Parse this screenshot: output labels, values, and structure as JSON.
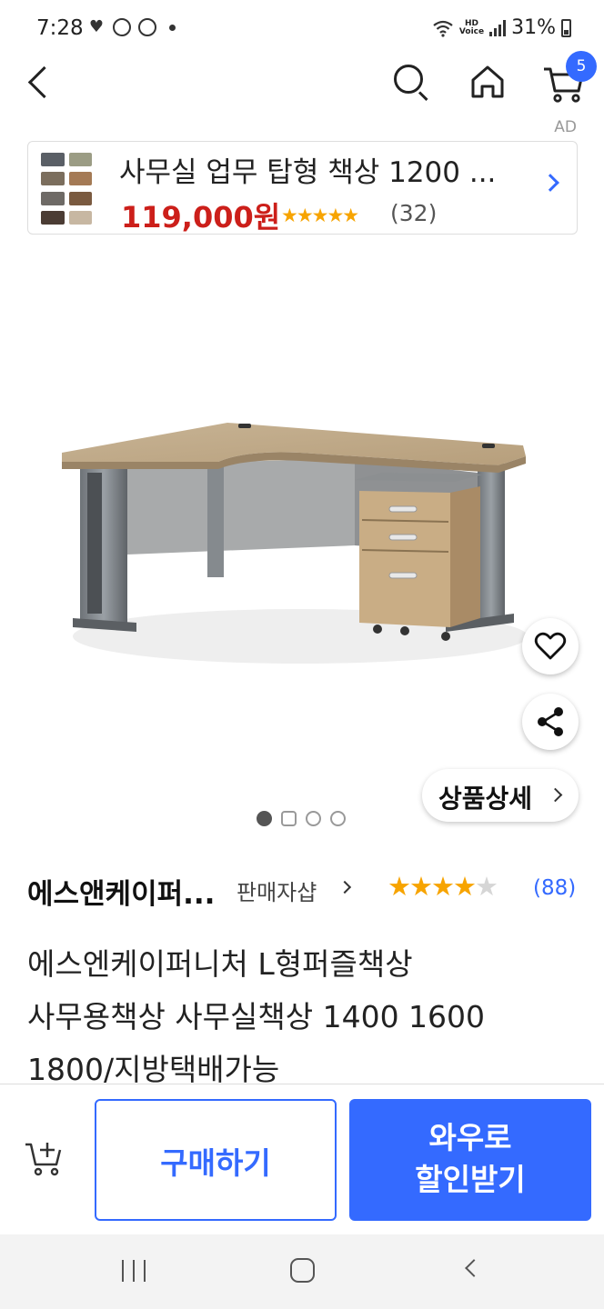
{
  "status_bar": {
    "time": "7:28",
    "battery": "31%",
    "hd_label": "HD",
    "voice_label": "Voice"
  },
  "top_nav": {
    "cart_count": "5"
  },
  "ad": {
    "label": "AD",
    "title": "사무실 업무 탑형 책상 1200 ...",
    "price": "119,000원",
    "stars": "★★★★★",
    "review_count": "(32)",
    "rating": 5
  },
  "product_image": {
    "detail_button_label": "상품상세"
  },
  "seller": {
    "name": "에스앤케이퍼...",
    "link_label": "판매자샵",
    "stars_on": "★★★★",
    "stars_off": "★",
    "rating": 4,
    "review_count": "(88)"
  },
  "product": {
    "title_line1": "에스엔케이퍼니처 L형퍼즐책상",
    "title_line2": "사무용책상 사무실책상 1400 1600",
    "title_line3": "1800/지방택배가능"
  },
  "buy_bar": {
    "buy_label": "구매하기",
    "wow_label_line1": "와우로",
    "wow_label_line2": "할인받기"
  },
  "colors": {
    "accent": "#346aff",
    "price_red": "#cc1f1a",
    "star": "#f7a400"
  }
}
